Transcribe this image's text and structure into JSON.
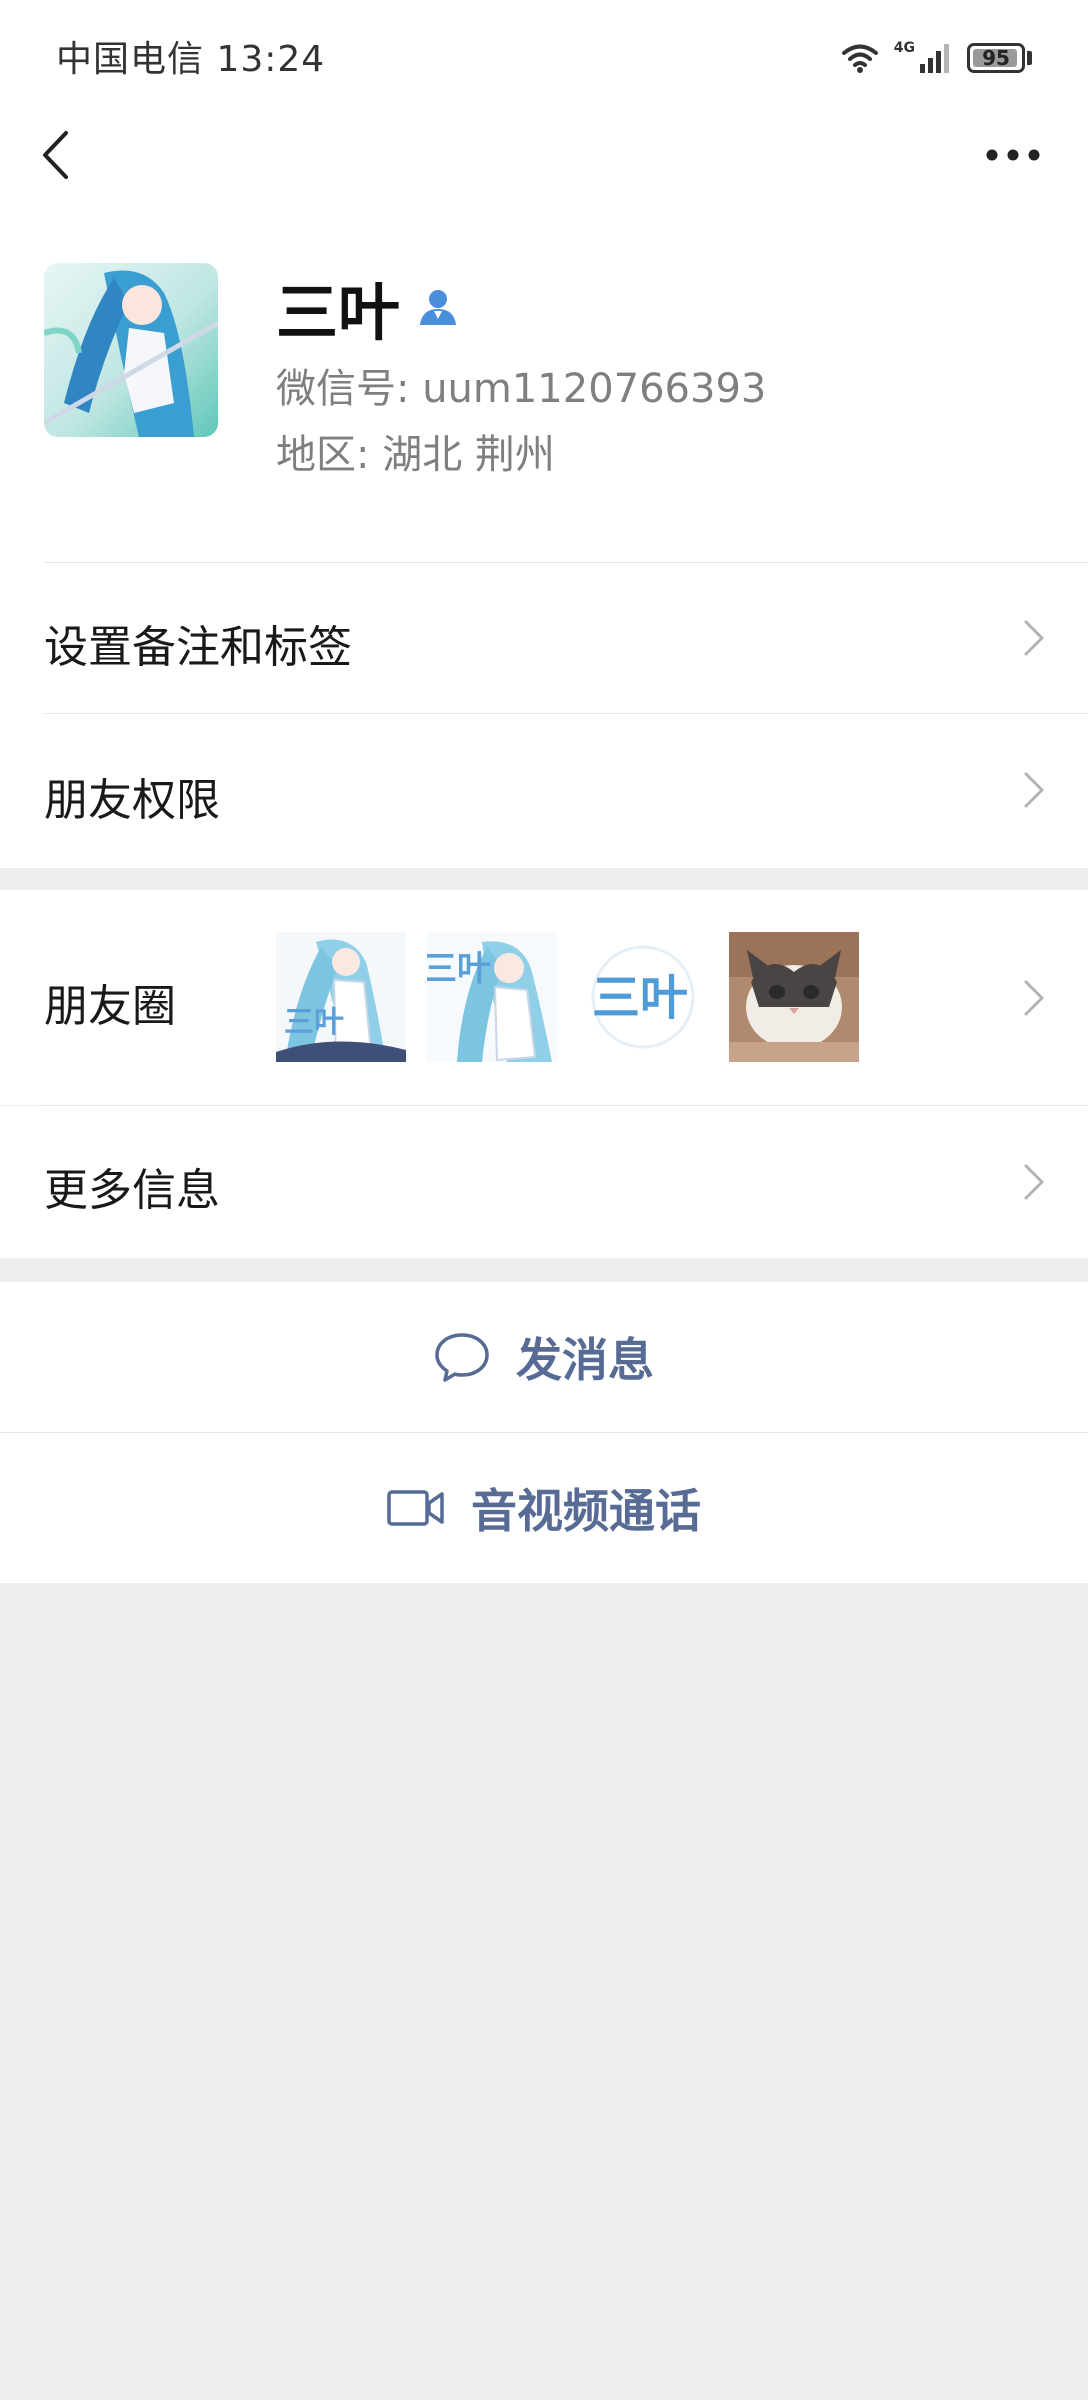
{
  "status_bar": {
    "carrier_time": "中国电信 13:24",
    "network": "4G",
    "battery": "95",
    "battery_level": 0.95
  },
  "nav": {
    "back_icon": "chevron-left-icon",
    "more_icon": "more-dots-icon"
  },
  "profile": {
    "name": "三叶",
    "wechat_id": "微信号: uum1120766393",
    "region": "地区: 湖北  荆州",
    "badge_icon": "person-badge-icon"
  },
  "menu": {
    "remarks_tags": "设置备注和标签",
    "friend_permissions": "朋友权限",
    "moments": "朋友圈",
    "more_info": "更多信息"
  },
  "moments_thumbs": [
    {
      "icon": "anime-girl-thumbnail",
      "text": "三叶"
    },
    {
      "icon": "anime-girl-thumbnail",
      "text": "三叶"
    },
    {
      "icon": "logo-thumbnail",
      "text": "三叶"
    },
    {
      "icon": "cat-photo-thumbnail",
      "text": ""
    }
  ],
  "actions": {
    "send_message": "发消息",
    "video_call": "音视频通话"
  },
  "colors": {
    "link_blue": "#576b95",
    "background": "#ededed",
    "badge_blue": "#4a8fdc"
  }
}
